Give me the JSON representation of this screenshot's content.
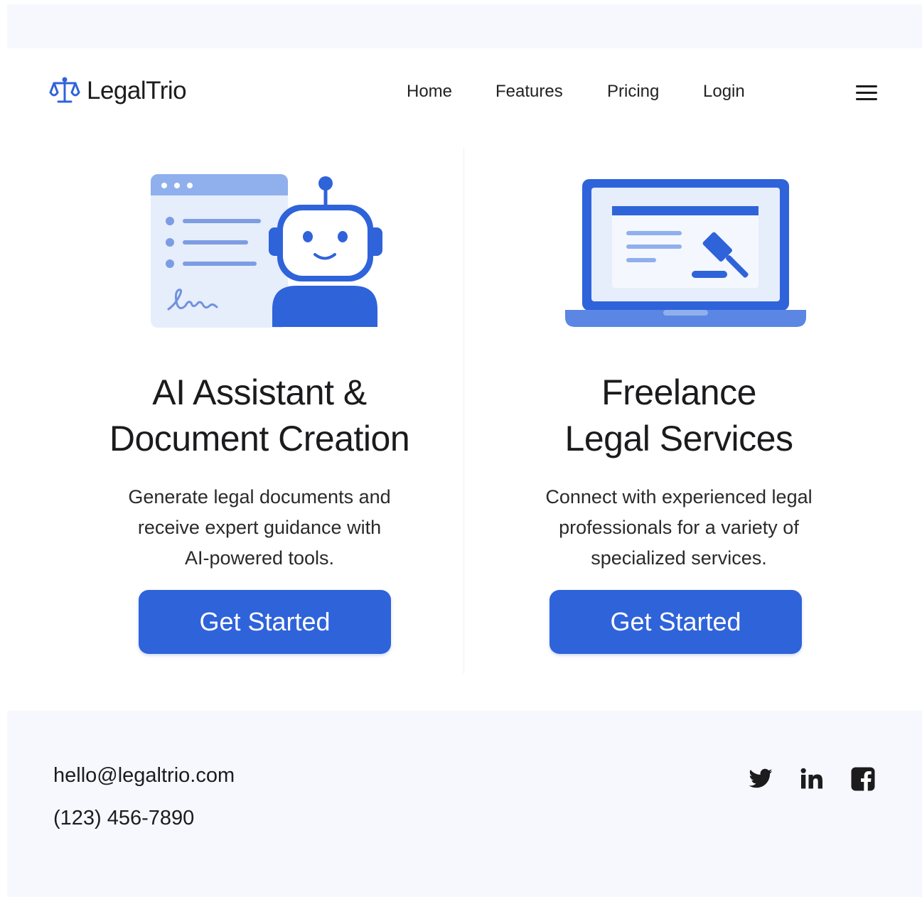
{
  "brand": {
    "name": "LegalTrio",
    "logo_icon": "scales-of-justice-icon",
    "accent": "#2f63da"
  },
  "nav": {
    "items": [
      {
        "label": "Home"
      },
      {
        "label": "Features"
      },
      {
        "label": "Pricing"
      },
      {
        "label": "Login"
      }
    ],
    "menu_icon": "hamburger-menu-icon"
  },
  "cards": [
    {
      "illustration": "robot-assistant-document-illustration",
      "title_line1": "AI Assistant &",
      "title_line2": "Document Creation",
      "desc_line1": "Generate legal documents and",
      "desc_line2": "receive expert guidance with",
      "desc_line3": "AI-powered tools.",
      "button_label": "Get Started"
    },
    {
      "illustration": "laptop-gavel-illustration",
      "title_line1": "Freelance",
      "title_line2": "Legal Services",
      "desc_line1": "Connect with experienced legal",
      "desc_line2": "professionals for a variety of",
      "desc_line3": "specialized services.",
      "button_label": "Get Started"
    }
  ],
  "footer": {
    "email": "hello@legaltrio.com",
    "phone": "(123) 456-7890",
    "social": [
      "twitter-icon",
      "linkedin-icon",
      "facebook-icon"
    ]
  }
}
